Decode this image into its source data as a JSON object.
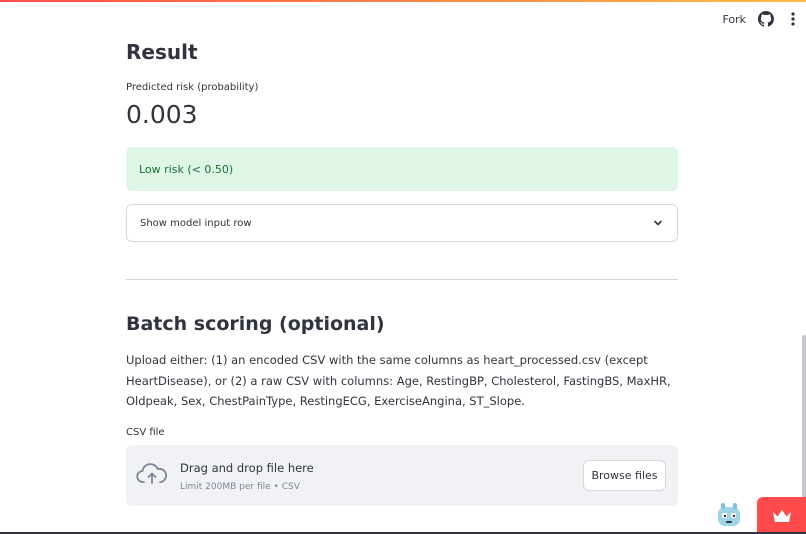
{
  "header": {
    "fork_label": "Fork",
    "github_icon": "github-icon",
    "menu_icon": "kebab-menu-icon"
  },
  "result": {
    "title": "Result",
    "metric_label": "Predicted risk (probability)",
    "metric_value": "0.003",
    "alert_text": "Low risk (< 0.50)",
    "expander_label": "Show model input row"
  },
  "batch": {
    "title": "Batch scoring (optional)",
    "description": "Upload either: (1) an encoded CSV with the same columns as heart_processed.csv (except HeartDisease), or (2) a raw CSV with columns: Age, RestingBP, Cholesterol, FastingBS, MaxHR, Oldpeak, Sex, ChestPainType, RestingECG, ExerciseAngina, ST_Slope.",
    "uploader_label": "CSV file",
    "dropzone_title": "Drag and drop file here",
    "dropzone_subtitle": "Limit 200MB per file • CSV",
    "browse_label": "Browse files"
  },
  "colors": {
    "accent": "#ff4b4b",
    "success_bg": "#dff5e6",
    "success_text": "#177233"
  }
}
